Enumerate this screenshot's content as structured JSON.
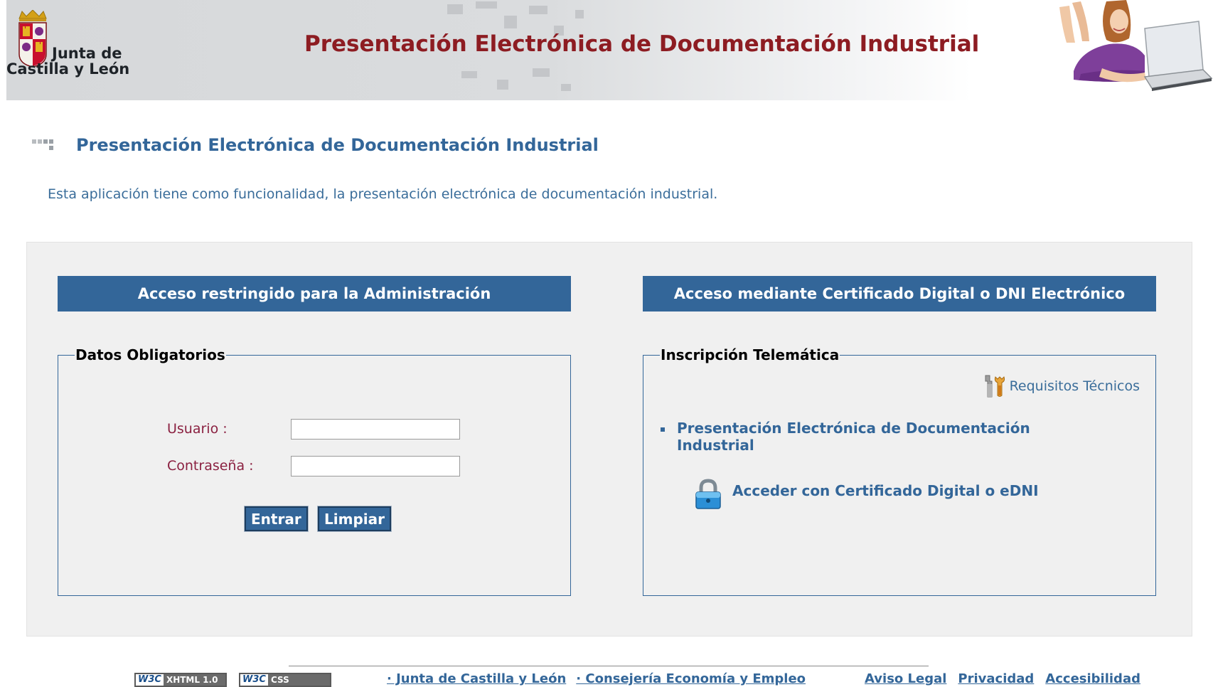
{
  "header": {
    "logo_line1": "Junta de",
    "logo_line2": "Castilla y León",
    "app_title": "Presentación Electrónica de Documentación Industrial"
  },
  "page": {
    "title": "Presentación Electrónica de Documentación Industrial",
    "description": "Esta aplicación tiene como funcionalidad, la presentación electrónica de documentación industrial."
  },
  "admin": {
    "header": "Acceso restringido para la Administración",
    "legend": "Datos Obligatorios",
    "user_label": "Usuario :",
    "user_value": "",
    "password_label": "Contraseña :",
    "password_value": "",
    "enter_button": "Entrar",
    "clear_button": "Limpiar"
  },
  "cert": {
    "header": "Acceso mediante Certificado Digital o DNI Electrónico",
    "legend": "Inscripción Telemática",
    "requirements_link": "Requisitos Técnicos",
    "procedure_link": "Presentación Electrónica de Documentación Industrial",
    "access_link": "Acceder con Certificado Digital o eDNI"
  },
  "footer": {
    "badge_xhtml": "XHTML 1.0",
    "badge_css": "CSS",
    "badge_w3c": "W3C",
    "links_left": [
      "· Junta de Castilla y León",
      "· Consejería Economía y Empleo"
    ],
    "links_right": [
      "Aviso Legal",
      "Privacidad",
      "Accesibilidad"
    ]
  },
  "colors": {
    "brand_red": "#8d1c22",
    "accent_blue": "#336699",
    "panel_bg": "#f0f0f0",
    "label_color": "#8a2040"
  }
}
